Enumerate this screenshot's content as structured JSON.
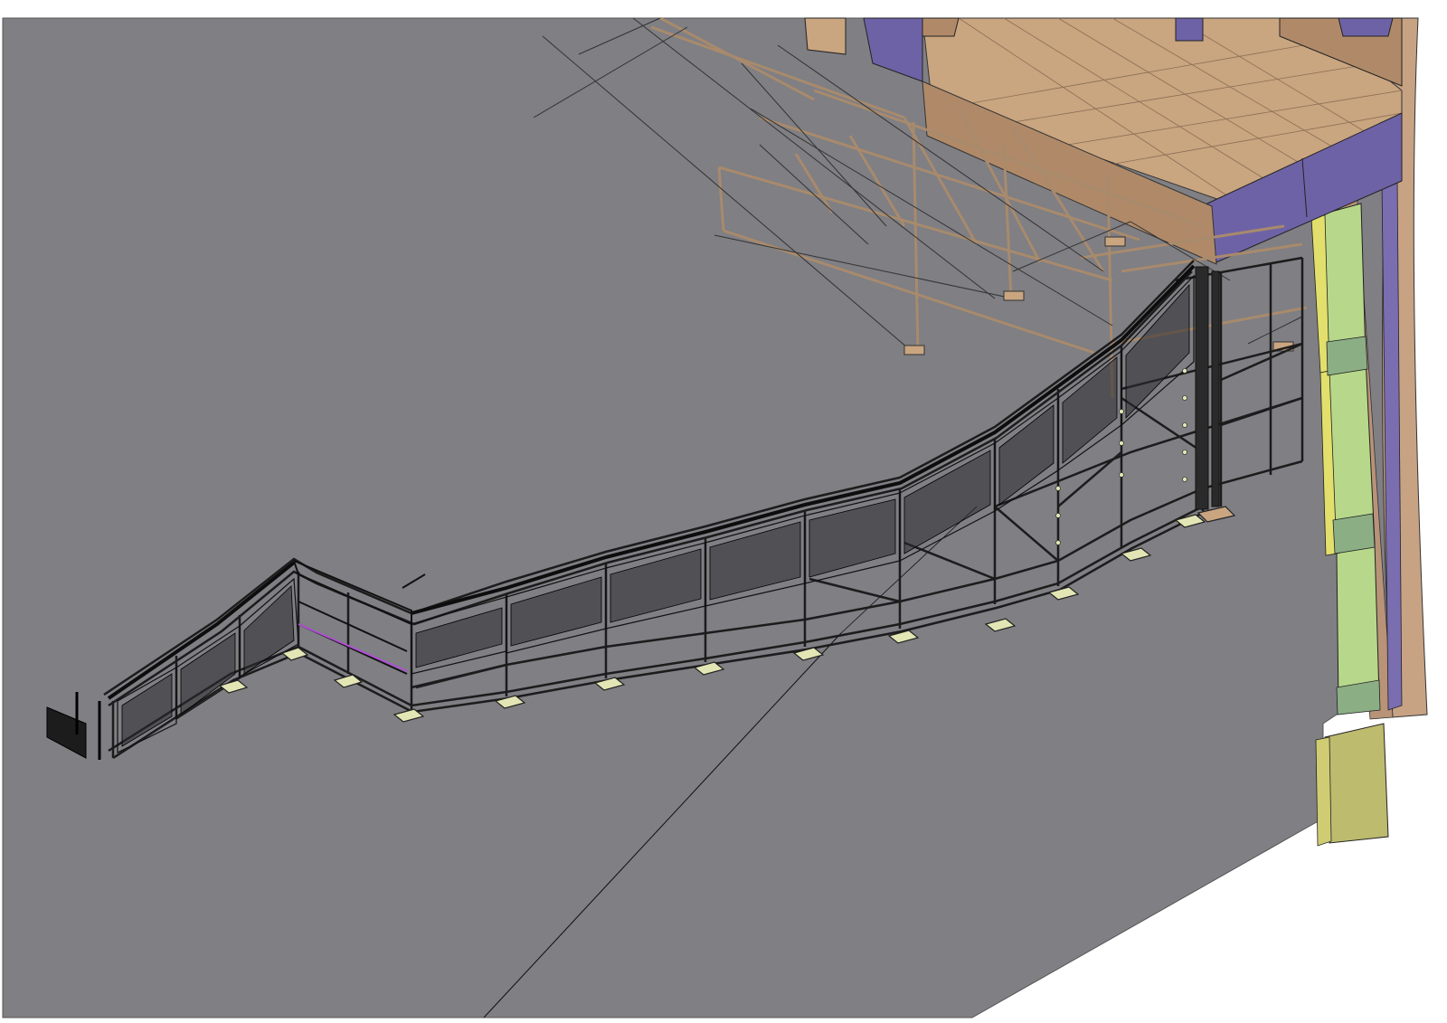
{
  "drawing": {
    "view": "isometric",
    "colors": {
      "paper": "#ffffff",
      "ground": "#7f7f84",
      "deck": "#c9a580",
      "deck_dark": "#b08a68",
      "panel": "#6e62a6",
      "steel": "#1c1c1c",
      "footing": "#e3e6b4",
      "rail_green": "#b7d88a",
      "rail_yellow": "#e2df6c",
      "rail_olive": "#bdbb6e",
      "scaffold": "#a88a6c",
      "highlight": "#b04fd6"
    }
  }
}
